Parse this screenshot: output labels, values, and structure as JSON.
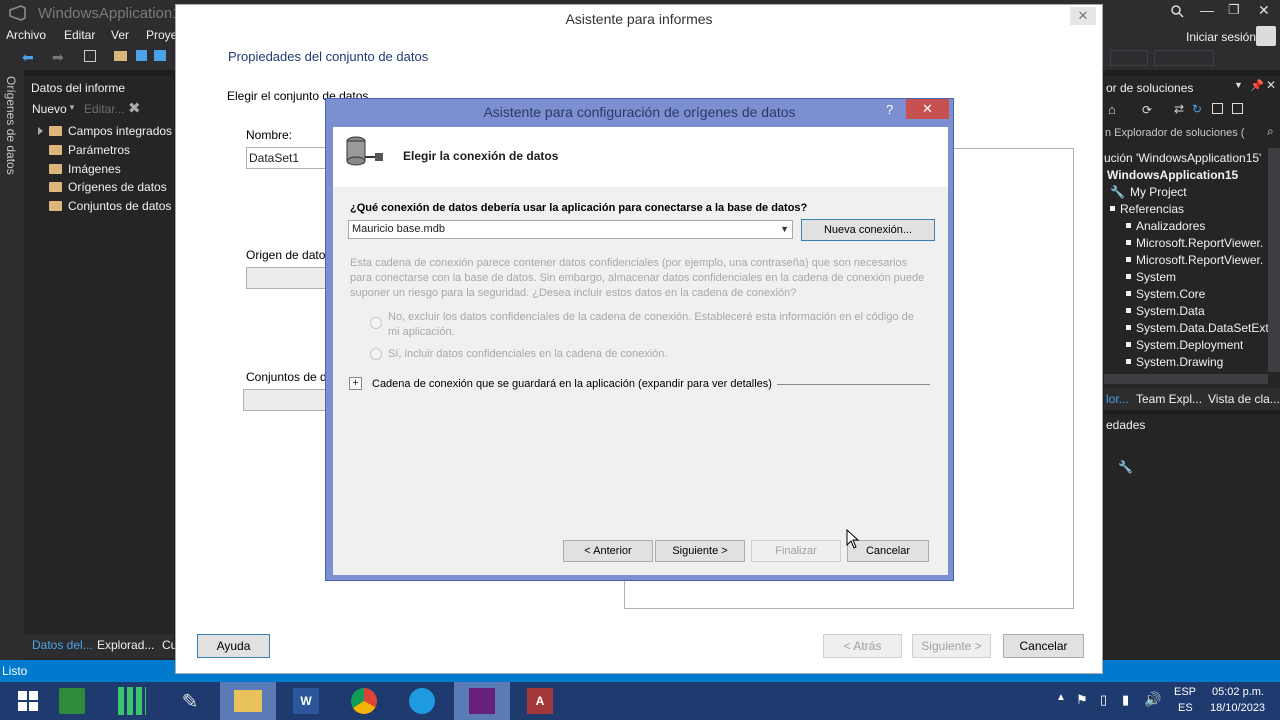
{
  "vs": {
    "title": "WindowsApplication1",
    "menu": [
      "Archivo",
      "Editar",
      "Ver",
      "Proye"
    ],
    "signin": "Iniciar sesión",
    "vertical_tab": "Orígenes de datos",
    "status": "Listo"
  },
  "report_panel": {
    "title": "Datos del informe",
    "new_label": "Nuevo",
    "edit_label": "Editar...",
    "items": [
      "Campos integrados",
      "Parámetros",
      "Imágenes",
      "Orígenes de datos",
      "Conjuntos de datos"
    ],
    "bottom_tabs": [
      "Datos del...",
      "Explorad...",
      "Cu"
    ]
  },
  "solution_panel": {
    "title": "or de soluciones",
    "search": "n Explorador de soluciones (",
    "rows": [
      "ución 'WindowsApplication15'",
      "WindowsApplication15",
      "My Project",
      "Referencias",
      "Analizadores",
      "Microsoft.ReportViewer.",
      "Microsoft.ReportViewer.",
      "System",
      "System.Core",
      "System.Data",
      "System.Data.DataSetExte",
      "System.Deployment",
      "System.Drawing"
    ],
    "tabs": [
      "lor...",
      "Team Expl...",
      "Vista de cla..."
    ],
    "props_title": "edades"
  },
  "wizard": {
    "title": "Asistente para informes",
    "heading": "Propiedades del conjunto de datos",
    "choose_dataset": "Elegir el conjunto de datos",
    "name_label": "Nombre:",
    "name_value": "DataSet1",
    "source_label": "Origen de datos",
    "datasets_label": "Conjuntos de da",
    "help_button": "Ayuda",
    "back_button": "< Atrás",
    "next_button": "Siguiente >",
    "cancel_button": "Cancelar"
  },
  "ds_dialog": {
    "title": "Asistente para configuración de orígenes de datos",
    "help": "?",
    "close": "✕",
    "header": "Elegir la conexión de datos",
    "question": "¿Qué conexión de datos debería usar la aplicación para conectarse a la base de datos?",
    "connection": "Mauricio base.mdb",
    "new_connection": "Nueva conexión...",
    "warning": "Esta cadena de conexión parece contener datos confidenciales (por ejemplo, una contraseña) que son necesarios para conectarse con la base de datos. Sin embargo, almacenar datos confidenciales en la cadena de conexión puede suponer un riesgo para la seguridad. ¿Desea incluir estos datos en la cadena de conexión?",
    "option_no": "No, excluir los datos confidenciales de la cadena de conexión. Estableceré esta información en el código de mi aplicación.",
    "option_yes": "Sí, incluir datos confidenciales en la cadena de conexión.",
    "expand_label": "Cadena de conexión que se guardará en la aplicación (expandir para ver detalles)",
    "back": "< Anterior",
    "next": "Siguiente >",
    "finish": "Finalizar",
    "cancel": "Cancelar"
  },
  "tray": {
    "lang": "ESP",
    "lang2": "ES",
    "time": "05:02 p.m.",
    "date": "18/10/2023"
  },
  "colors": {
    "vs_dark": "#2d2d30",
    "statusbar": "#007acc",
    "taskbar": "#1f3a6e",
    "dialog_frame": "#7b8fd1"
  }
}
